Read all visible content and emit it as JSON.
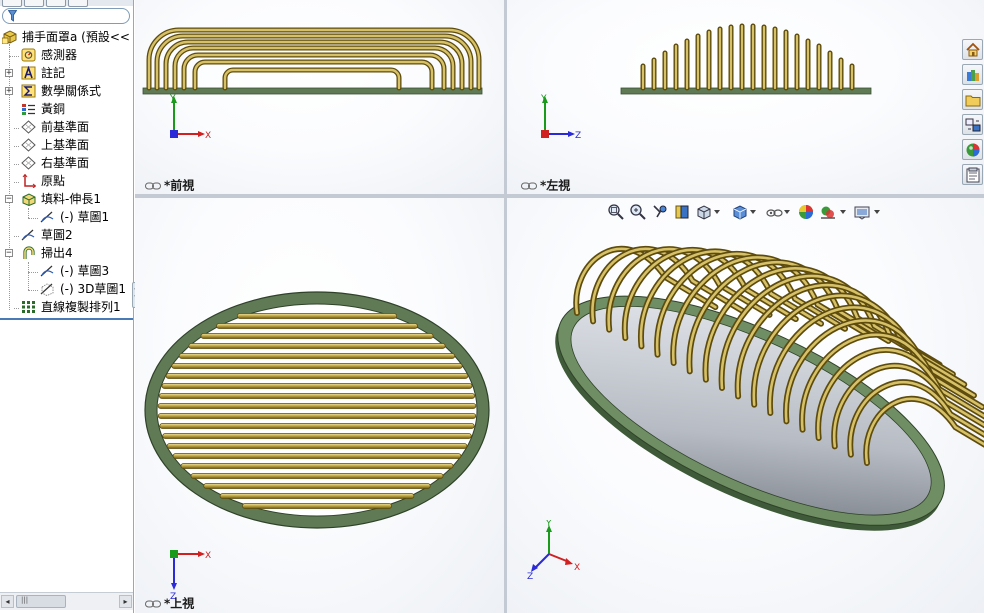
{
  "tree": {
    "root_label": "捕手面罩a  (預設<<",
    "items": [
      {
        "label": "感測器"
      },
      {
        "label": "註記"
      },
      {
        "label": "數學關係式"
      },
      {
        "label": "黃銅"
      },
      {
        "label": "前基準面"
      },
      {
        "label": "上基準面"
      },
      {
        "label": "右基準面"
      },
      {
        "label": "原點"
      },
      {
        "label": "填料-伸長1"
      },
      {
        "label": "(-) 草圖1"
      },
      {
        "label": "草圖2"
      },
      {
        "label": "掃出4"
      },
      {
        "label": "(-) 草圖3"
      },
      {
        "label": "(-) 3D草圖1"
      },
      {
        "label": "直線複製排列1"
      }
    ]
  },
  "viewports": {
    "front": {
      "label": "*前視"
    },
    "left": {
      "label": "*左視"
    },
    "top": {
      "label": "*上視"
    },
    "iso": {
      "label": ""
    }
  },
  "triad": {
    "x": "X",
    "y": "Y",
    "z": "Z"
  },
  "colors": {
    "brass": "#b9a040",
    "brass_dark": "#6d5a12",
    "brass_light": "#e6d58a",
    "base_green": "#5f7a55",
    "base_green_dark": "#3a5033",
    "axis_x": "#d02020",
    "axis_y": "#1a9a1a",
    "axis_z": "#2a2ad8"
  },
  "hud_icons": [
    "zoom-to-fit-icon",
    "zoom-to-area-icon",
    "previous-view-icon",
    "section-view-icon",
    "view-orientation-icon",
    "display-style-icon",
    "hide-show-items-icon",
    "edit-appearance-icon",
    "apply-scene-icon",
    "view-settings-icon"
  ],
  "task_pane_icons": [
    "home-resources-icon",
    "design-library-icon",
    "file-explorer-icon",
    "view-palette-icon",
    "appearances-scenes-icon",
    "custom-properties-icon"
  ]
}
